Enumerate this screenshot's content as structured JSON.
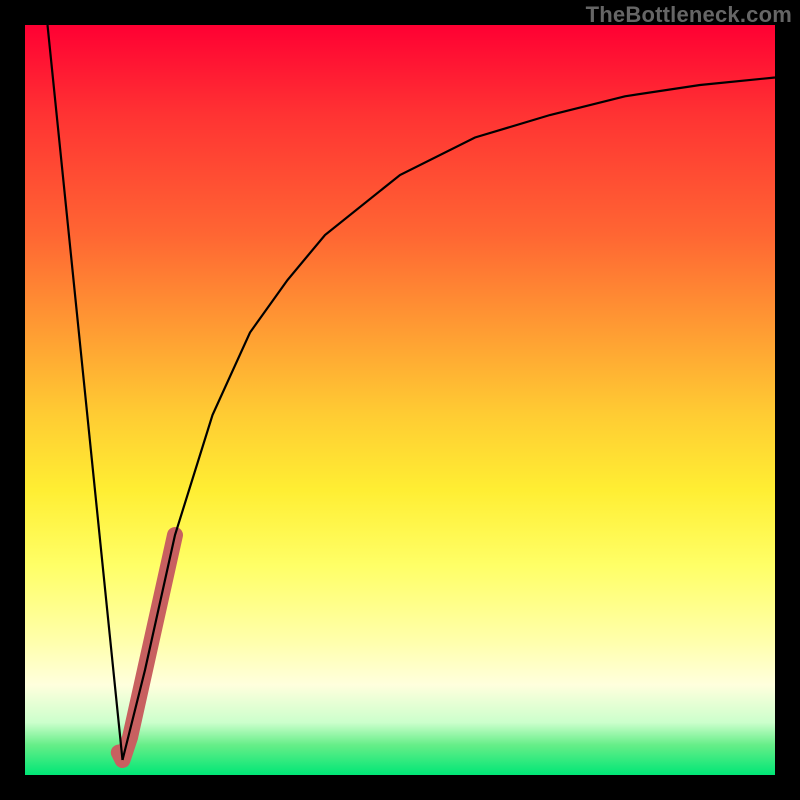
{
  "attribution": "TheBottleneck.com",
  "colors": {
    "frame": "#000000",
    "curve": "#000000",
    "highlight": "#c86060",
    "gradient_top": "#ff0033",
    "gradient_bottom": "#00e676"
  },
  "chart_data": {
    "type": "line",
    "xlabel": "",
    "ylabel": "",
    "xlim": [
      0,
      100
    ],
    "ylim": [
      0,
      100
    ],
    "legend": false,
    "grid": false,
    "series": [
      {
        "name": "left-falling-segment",
        "x": [
          3,
          13
        ],
        "y": [
          100,
          2
        ]
      },
      {
        "name": "rising-saturation-curve",
        "x": [
          13,
          16,
          20,
          25,
          30,
          35,
          40,
          50,
          60,
          70,
          80,
          90,
          100
        ],
        "y": [
          2,
          14,
          32,
          48,
          59,
          66,
          72,
          80,
          85,
          88,
          90.5,
          92,
          93
        ]
      },
      {
        "name": "highlighted-segment",
        "stroke": "#c86060",
        "stroke_width": 16,
        "x": [
          12.5,
          13,
          14,
          16,
          18,
          20
        ],
        "y": [
          3,
          2,
          5,
          14,
          23,
          32
        ]
      }
    ],
    "background_gradient": {
      "orientation": "vertical",
      "stops": [
        {
          "pos": 0.0,
          "color": "#ff0033"
        },
        {
          "pos": 0.28,
          "color": "#ff6633"
        },
        {
          "pos": 0.52,
          "color": "#ffcc33"
        },
        {
          "pos": 0.72,
          "color": "#ffff66"
        },
        {
          "pos": 0.88,
          "color": "#ffffdd"
        },
        {
          "pos": 0.96,
          "color": "#66ee88"
        },
        {
          "pos": 1.0,
          "color": "#00e676"
        }
      ]
    }
  }
}
